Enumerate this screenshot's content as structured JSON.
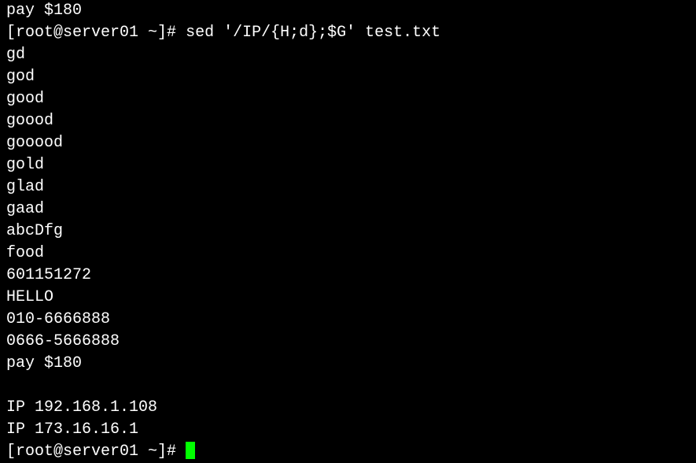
{
  "lines": {
    "partial_top": "pay $180",
    "prompt1_user": "[root@server01 ",
    "prompt1_path": "~",
    "prompt1_end": "]# ",
    "command1": "sed '/IP/{H;d};$G' test.txt",
    "out1": "gd",
    "out2": "god",
    "out3": "good",
    "out4": "goood",
    "out5": "gooood",
    "out6": "gold",
    "out7": "glad",
    "out8": "gaad",
    "out9": "abcDfg",
    "out10": "food",
    "out11": "601151272",
    "out12": "HELLO",
    "out13": "010-6666888",
    "out14": "0666-5666888",
    "out15": "pay $180",
    "out16": "",
    "out17": "IP 192.168.1.108",
    "out18": "IP 173.16.16.1",
    "prompt2_user": "[root@server01 ",
    "prompt2_path": "~",
    "prompt2_end": "]# "
  }
}
